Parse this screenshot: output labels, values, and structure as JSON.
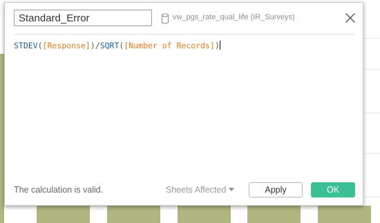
{
  "calc": {
    "name": "Standard_Error",
    "datasource": "vw_pgs_rate_qual_life (IR_Surveys)"
  },
  "formula": {
    "fn1": "STDEV",
    "open1": "(",
    "field1": "[Response]",
    "close1": ")",
    "slash": "/",
    "fn2": "SQRT",
    "open2": "(",
    "field2": "[Number of Records]",
    "close2": ")"
  },
  "footer": {
    "status": "The calculation is valid.",
    "sheets_affected": "Sheets Affected",
    "apply": "Apply",
    "ok": "OK"
  },
  "icons": {
    "datasource": "database-icon",
    "close": "close-icon",
    "sheets": "chevron-down-icon"
  },
  "colors": {
    "background_bars": "#b1b57f",
    "function": "#1f5f9a",
    "field": "#e07b1c",
    "ok_button": "#3cbf95"
  }
}
